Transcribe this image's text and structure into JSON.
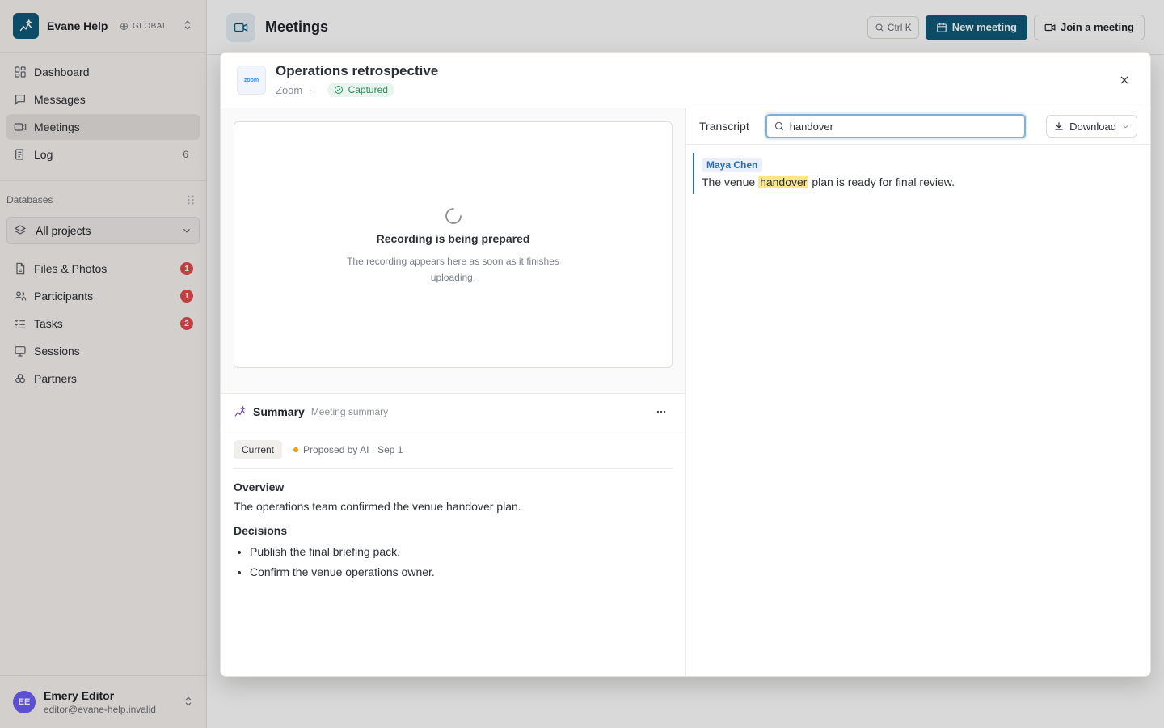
{
  "workspace": {
    "name": "Evane Help",
    "scope": "GLOBAL"
  },
  "nav": [
    {
      "label": "Dashboard",
      "icon": "dashboard-icon"
    },
    {
      "label": "Messages",
      "icon": "message-icon"
    },
    {
      "label": "Meetings",
      "icon": "video-icon",
      "active": true
    },
    {
      "label": "Log",
      "icon": "log-icon",
      "count": "6"
    }
  ],
  "databases": {
    "heading": "Databases",
    "project_select": "All projects",
    "items": [
      {
        "label": "Files & Photos",
        "icon": "file-icon",
        "badge": "1"
      },
      {
        "label": "Participants",
        "icon": "users-icon",
        "badge": "1"
      },
      {
        "label": "Tasks",
        "icon": "tasks-icon",
        "badge": "2"
      },
      {
        "label": "Sessions",
        "icon": "sessions-icon"
      },
      {
        "label": "Partners",
        "icon": "partners-icon"
      }
    ]
  },
  "user": {
    "initials": "EE",
    "name": "Emery Editor",
    "email": "editor@evane-help.invalid"
  },
  "page": {
    "title": "Meetings",
    "shortcut": "Ctrl K",
    "new_meeting": "New meeting",
    "join_meeting": "Join a meeting"
  },
  "modal": {
    "title": "Operations retrospective",
    "provider": "Zoom",
    "provider_logo": "zoom",
    "separator": "·",
    "status": "Captured",
    "recording": {
      "title": "Recording is being prepared",
      "description": "The recording appears here as soon as it finishes uploading."
    },
    "summary": {
      "title": "Summary",
      "tag": "Meeting summary",
      "current_version": "Current",
      "proposed": "Proposed by AI · Sep 1",
      "overview_heading": "Overview",
      "overview_text": "The operations team confirmed the venue handover plan.",
      "decisions_heading": "Decisions",
      "decisions": [
        "Publish the final briefing pack.",
        "Confirm the venue operations owner."
      ]
    },
    "transcript": {
      "title": "Transcript",
      "search_value": "handover",
      "download": "Download",
      "segments": [
        {
          "speaker": "Maya Chen",
          "before": "The venue",
          "highlight": "handover",
          "after": "plan is ready for final review."
        }
      ]
    }
  },
  "colors": {
    "brand": "#0f5a7a",
    "captured": "#2f8a5a",
    "highlight": "#fde68a",
    "badge": "#e5484d",
    "avatar": "#6d5df7"
  }
}
